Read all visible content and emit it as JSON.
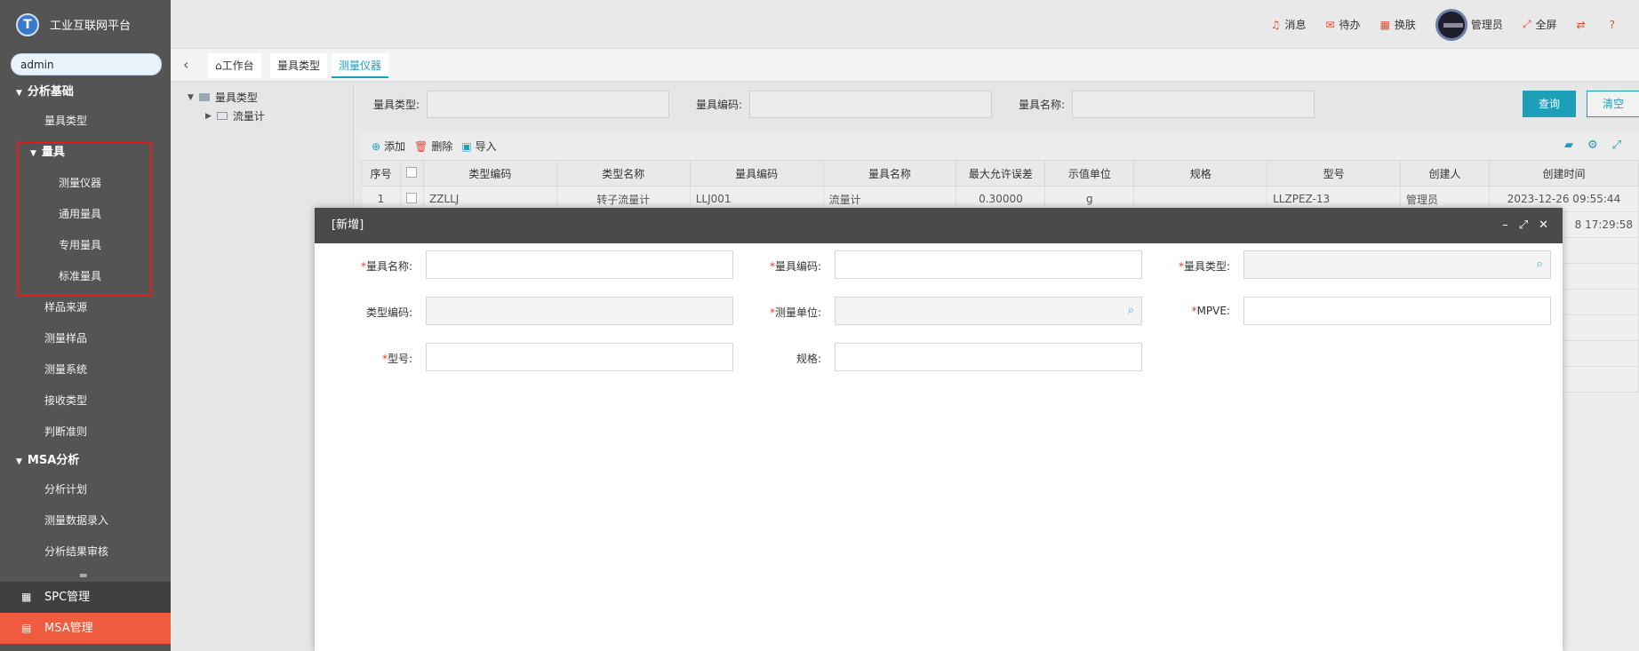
{
  "app": {
    "logo_letter": "T",
    "title": "工业互联网平台"
  },
  "user_field": "admin",
  "sidebar": {
    "group1": "分析基础",
    "item_type": "量具类型",
    "sub_group": "量具",
    "sub_items": [
      "测量仪器",
      "通用量具",
      "专用量具",
      "标准量具"
    ],
    "items_after": [
      "样品来源",
      "测量样品",
      "测量系统",
      "接收类型",
      "判断准则"
    ],
    "group2": "MSA分析",
    "msa_items": [
      "分析计划",
      "测量数据录入",
      "分析结果审核"
    ],
    "handle": "═",
    "spc": "SPC管理",
    "msa": "MSA管理"
  },
  "top_actions": {
    "message": "消息",
    "todo": "待办",
    "skin": "换肤",
    "admin": "管理员",
    "fullscreen": "全屏",
    "switch_icon": "⇄",
    "help_icon": "?"
  },
  "tabs": {
    "home": "工作台",
    "type": "量具类型",
    "meas": "测量仪器"
  },
  "tree": {
    "root": "量具类型",
    "child": "流量计"
  },
  "search": {
    "type_label": "量具类型:",
    "code_label": "量具编码:",
    "name_label": "量具名称:",
    "query": "查询",
    "clear": "清空"
  },
  "toolbar": {
    "add": "添加",
    "delete": "删除",
    "import": "导入"
  },
  "table": {
    "headers": [
      "序号",
      "",
      "类型编码",
      "类型名称",
      "量具编码",
      "量具名称",
      "最大允许误差",
      "示值单位",
      "规格",
      "型号",
      "创建人",
      "创建时间"
    ],
    "rows": [
      [
        "1",
        "",
        "ZZLLJ",
        "转子流量计",
        "LLJ001",
        "流量计",
        "0.30000",
        "g",
        "",
        "LLZPEZ-13",
        "管理员",
        "2023-12-26 09:55:44"
      ],
      [
        "",
        "",
        "",
        "",
        "",
        "",
        "",
        "",
        "",
        "",
        "",
        "8 17:29:58"
      ]
    ]
  },
  "modal": {
    "title": "[新增]",
    "minimize": "–",
    "maximize": "⤢",
    "close": "✕",
    "fields": {
      "name": "量具名称:",
      "code": "量具编码:",
      "type": "量具类型:",
      "type_code": "类型编码:",
      "unit": "测量单位:",
      "mpve": "MPVE:",
      "model": "型号:",
      "spec": "规格:"
    },
    "required_mark": "*"
  },
  "colors": {
    "accent": "#1e9fb8",
    "sidebar": "#545454",
    "msa_active": "#ee5b3e",
    "highlight_box": "#e0201b"
  }
}
